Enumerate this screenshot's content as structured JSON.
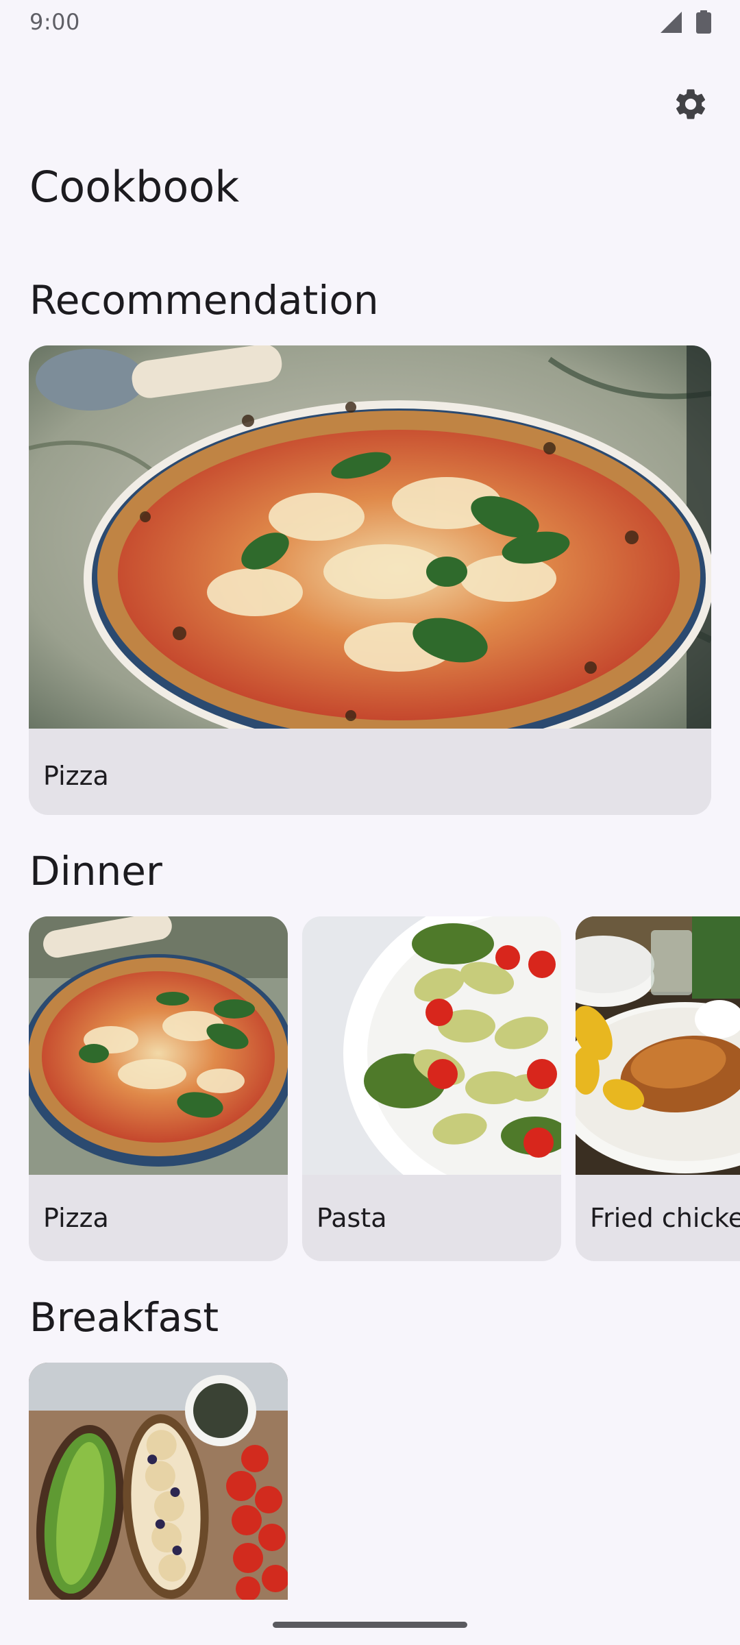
{
  "status_bar": {
    "time": "9:00"
  },
  "header": {
    "title": "Cookbook",
    "settings_icon": "gear-icon"
  },
  "sections": {
    "recommendation": {
      "title": "Recommendation",
      "items": [
        {
          "label": "Pizza",
          "image": "pizza"
        }
      ]
    },
    "dinner": {
      "title": "Dinner",
      "items": [
        {
          "label": "Pizza",
          "image": "pizza"
        },
        {
          "label": "Pasta",
          "image": "pasta-salad"
        },
        {
          "label": "Fried chicken",
          "image": "fried-chicken"
        }
      ]
    },
    "breakfast": {
      "title": "Breakfast",
      "items": [
        {
          "label": "",
          "image": "breakfast-toasts"
        }
      ]
    }
  },
  "colors": {
    "background": "#f7f5fb",
    "card_surface": "#e4e2e8",
    "text_primary": "#1c1b1f",
    "icon": "#424246"
  }
}
